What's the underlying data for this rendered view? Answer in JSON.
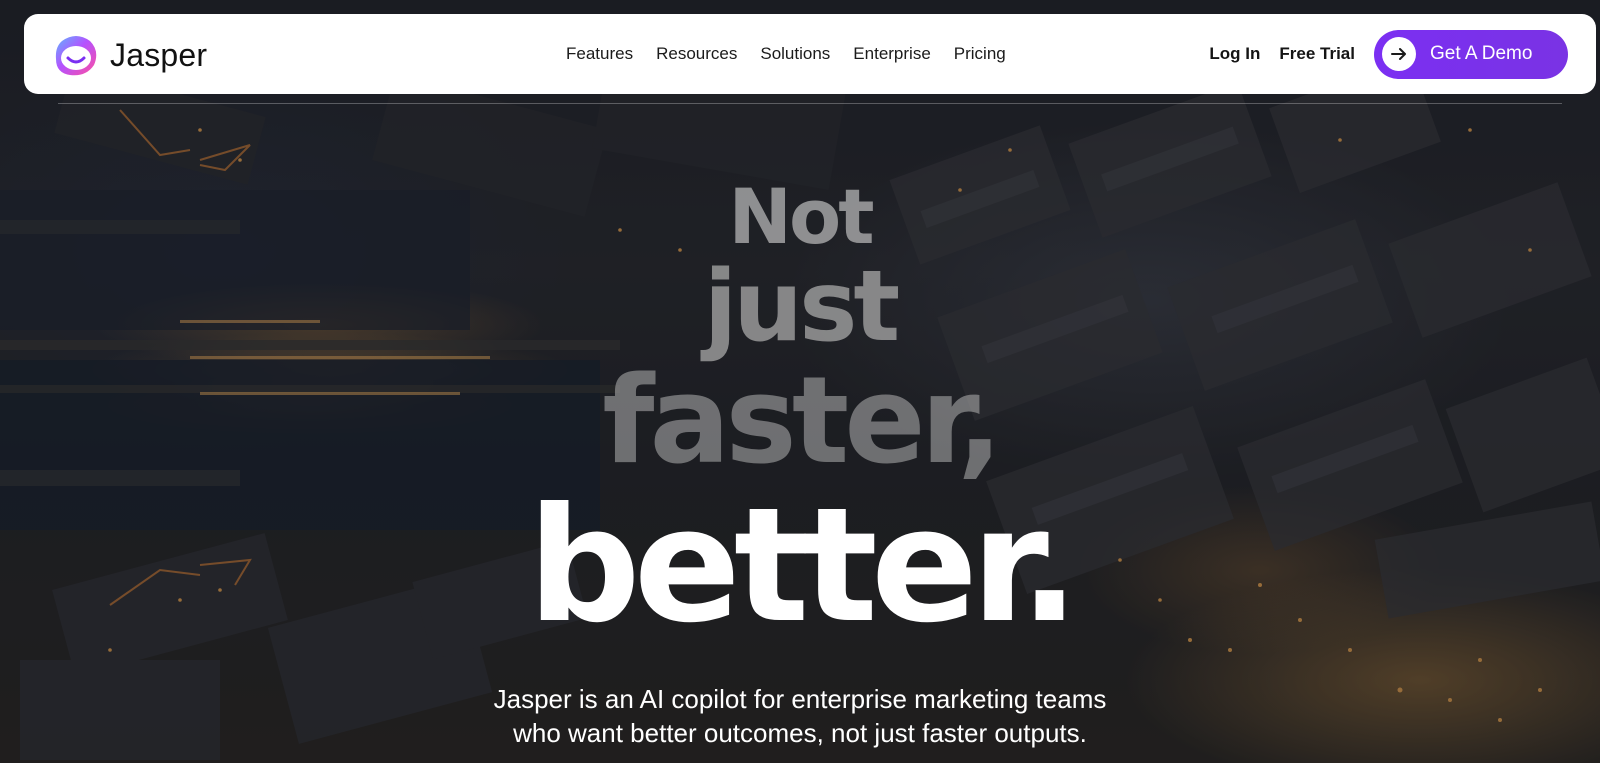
{
  "brand": {
    "name": "Jasper"
  },
  "nav": {
    "items": [
      {
        "label": "Features"
      },
      {
        "label": "Resources"
      },
      {
        "label": "Solutions"
      },
      {
        "label": "Enterprise"
      },
      {
        "label": "Pricing"
      }
    ],
    "login_label": "Log In",
    "free_trial_label": "Free Trial",
    "demo_label": "Get A Demo"
  },
  "hero": {
    "line1": "Not",
    "line2": "just",
    "line3": "faster,",
    "line4": "better.",
    "subtitle_line1": "Jasper is an AI copilot for enterprise marketing teams",
    "subtitle_line2": "who want better outcomes, not just faster outputs."
  },
  "colors": {
    "accent": "#7B2FF2",
    "navbar_bg": "#FFFFFF",
    "hero_text": "#FFFFFF",
    "hero_text_faded": "#AFAFAF"
  },
  "icons": {
    "logo": "jasper-face-icon",
    "demo_arrow": "arrow-right-icon"
  }
}
